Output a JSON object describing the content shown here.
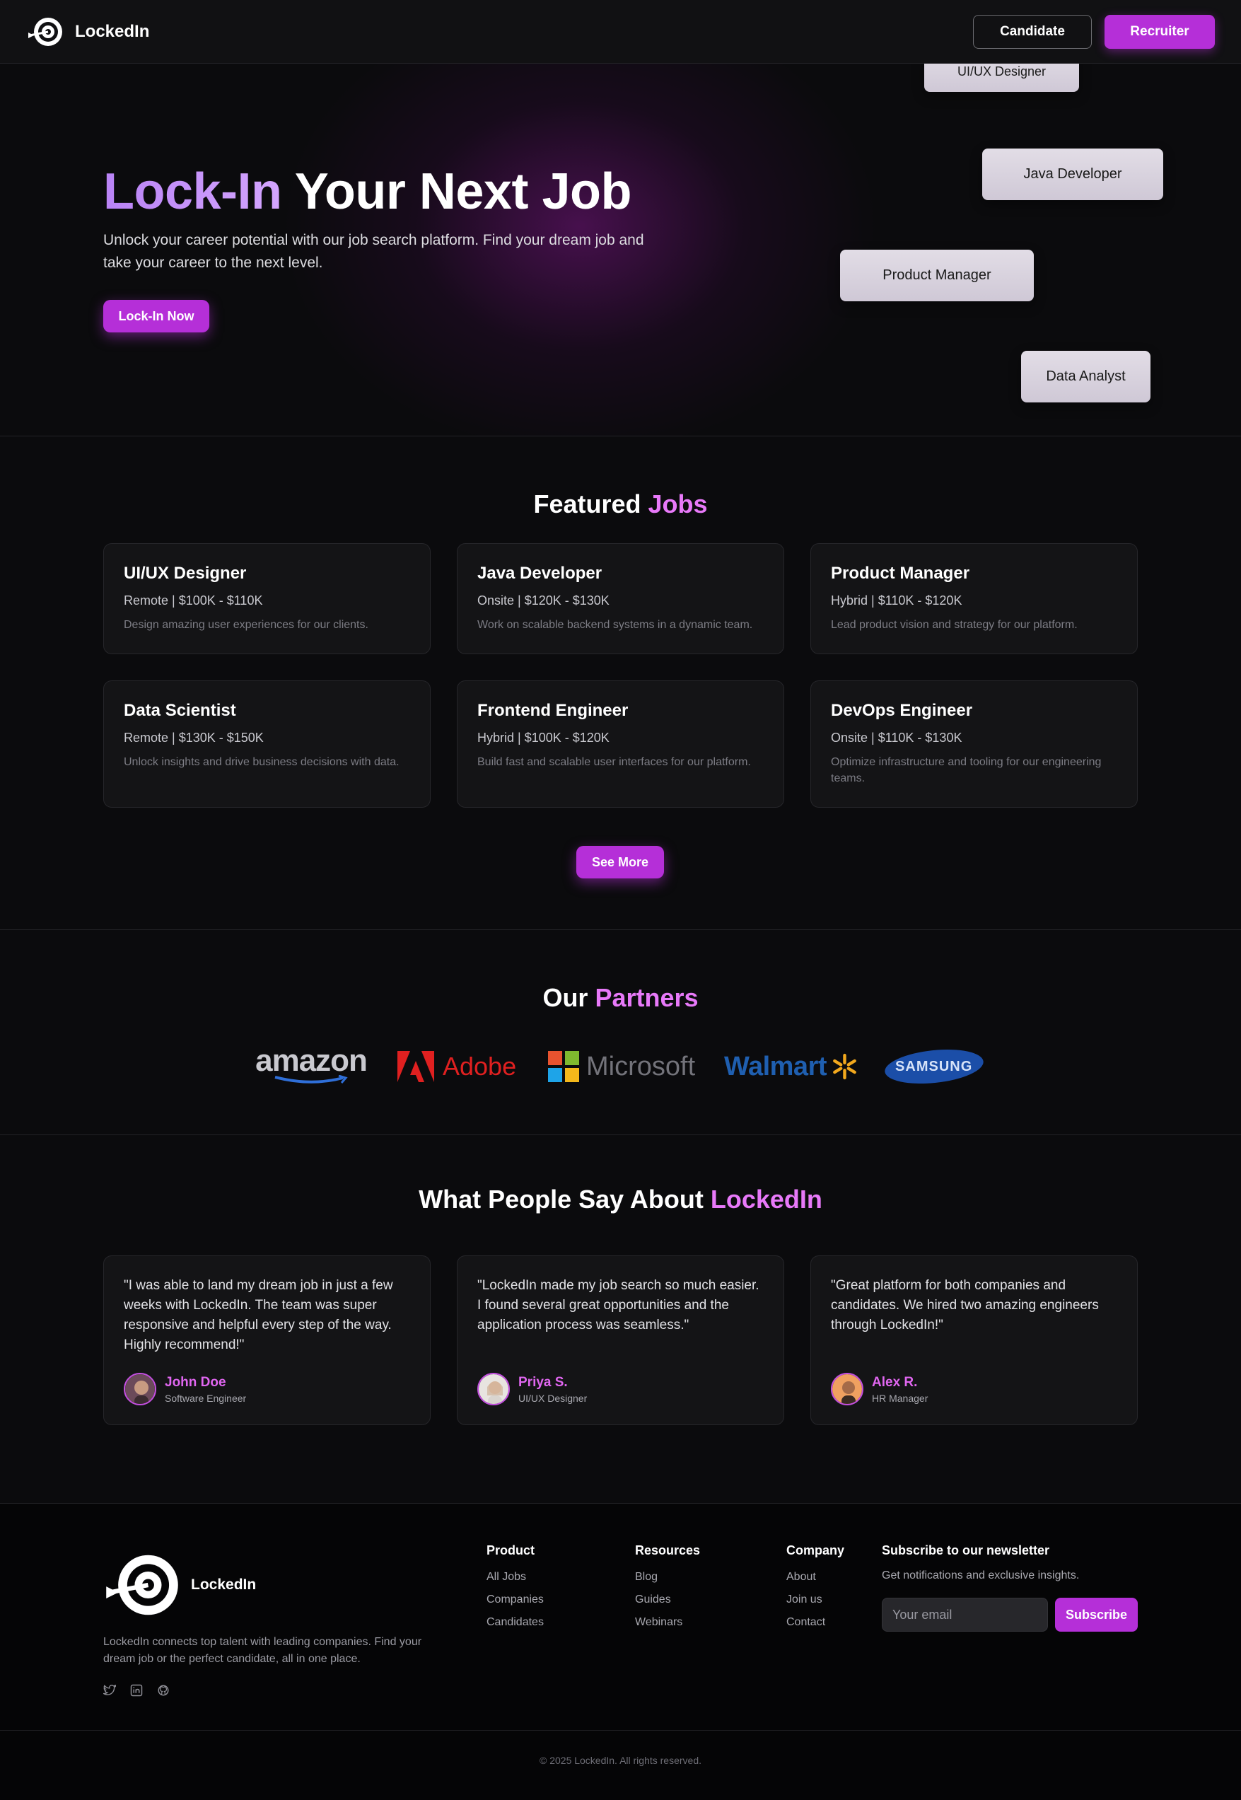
{
  "nav": {
    "brand": "LockedIn",
    "candidate_label": "Candidate",
    "recruiter_label": "Recruiter"
  },
  "hero": {
    "title_accent": "Lock-In",
    "title_rest": " Your Next Job",
    "subtitle": "Unlock your career potential with our job search platform. Find your dream job and take your career to the next level.",
    "cta_label": "Lock-In Now",
    "chips": [
      "UI/UX Designer",
      "Java Developer",
      "Product Manager",
      "Data Analyst"
    ]
  },
  "featured": {
    "title": "Featured",
    "title_accent": "Jobs",
    "jobs": [
      {
        "title": "UI/UX Designer",
        "meta": "Remote | $100K - $110K",
        "desc": "Design amazing user experiences for our clients."
      },
      {
        "title": "Java Developer",
        "meta": "Onsite | $120K - $130K",
        "desc": "Work on scalable backend systems in a dynamic team."
      },
      {
        "title": "Product Manager",
        "meta": "Hybrid | $110K - $120K",
        "desc": "Lead product vision and strategy for our platform."
      },
      {
        "title": "Data Scientist",
        "meta": "Remote | $130K - $150K",
        "desc": "Unlock insights and drive business decisions with data."
      },
      {
        "title": "Frontend Engineer",
        "meta": "Hybrid | $100K - $120K",
        "desc": "Build fast and scalable user interfaces for our platform."
      },
      {
        "title": "DevOps Engineer",
        "meta": "Onsite | $110K - $130K",
        "desc": "Optimize infrastructure and tooling for our engineering teams."
      }
    ],
    "see_more_label": "See More"
  },
  "partners": {
    "title": "Our",
    "title_accent": "Partners",
    "logos": [
      "amazon",
      "Adobe",
      "Microsoft",
      "Walmart",
      "SAMSUNG"
    ]
  },
  "testimonials": {
    "title": "What People Say About",
    "title_accent": "LockedIn",
    "items": [
      {
        "quote": "\"I was able to land my dream job in just a few weeks with LockedIn. The team was super responsive and helpful every step of the way. Highly recommend!\"",
        "name": "John Doe",
        "role": "Software Engineer"
      },
      {
        "quote": "\"LockedIn made my job search so much easier. I found several great opportunities and the application process was seamless.\"",
        "name": "Priya S.",
        "role": "UI/UX Designer"
      },
      {
        "quote": "\"Great platform for both companies and candidates. We hired two amazing engineers through LockedIn!\"",
        "name": "Alex R.",
        "role": "HR Manager"
      }
    ]
  },
  "footer": {
    "brand": "LockedIn",
    "description": "LockedIn connects top talent with leading companies. Find your dream job or the perfect candidate, all in one place.",
    "columns": [
      {
        "title": "Product",
        "links": [
          "All Jobs",
          "Companies",
          "Candidates"
        ]
      },
      {
        "title": "Resources",
        "links": [
          "Blog",
          "Guides",
          "Webinars"
        ]
      },
      {
        "title": "Company",
        "links": [
          "About",
          "Join us",
          "Contact"
        ]
      }
    ],
    "newsletter_title": "Subscribe to our newsletter",
    "newsletter_sub": "Get notifications and exclusive insights.",
    "email_placeholder": "Your email",
    "subscribe_label": "Subscribe",
    "copyright": "© 2025 LockedIn. All rights reserved.",
    "social_icons": [
      "twitter-icon",
      "linkedin-icon",
      "github-icon"
    ]
  },
  "colors": {
    "accent": "#b52fd8",
    "accent_text": "#e879f9",
    "hero_accent": "#c084fc",
    "background": "#0b0b0d"
  }
}
